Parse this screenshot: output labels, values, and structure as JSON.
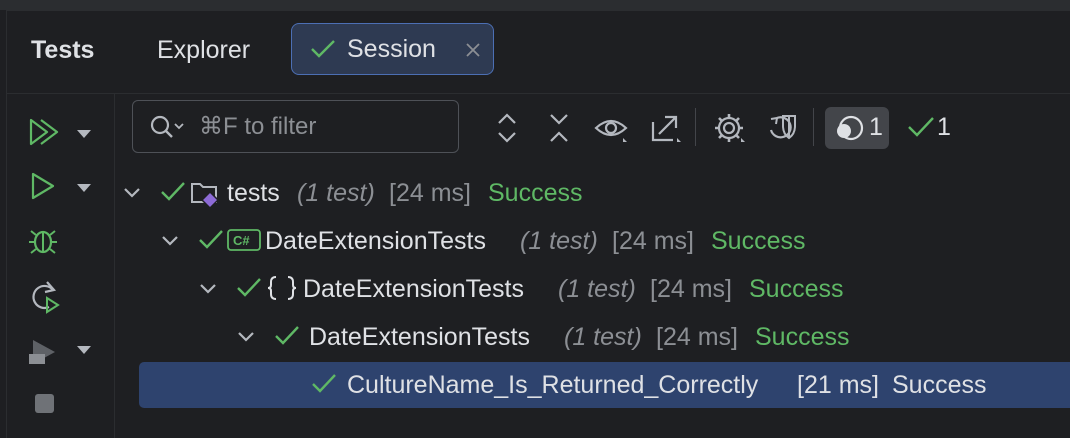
{
  "tabs": {
    "tests": "Tests",
    "explorer": "Explorer",
    "session": "Session"
  },
  "filter": {
    "placeholder": "⌘F to filter"
  },
  "counters": {
    "total": "1",
    "passed": "1"
  },
  "tree": [
    {
      "name": "tests",
      "count": "(1 test)",
      "time": "[24 ms]",
      "status": "Success",
      "icon": "folder-icon"
    },
    {
      "name": "DateExtensionTests",
      "count": "(1 test)",
      "time": "[24 ms]",
      "status": "Success",
      "icon": "csharp-file-icon"
    },
    {
      "name": "DateExtensionTests",
      "count": "(1 test)",
      "time": "[24 ms]",
      "status": "Success",
      "icon": "namespace-icon"
    },
    {
      "name": "DateExtensionTests",
      "count": "(1 test)",
      "time": "[24 ms]",
      "status": "Success",
      "icon": ""
    },
    {
      "name": "CultureName_Is_Returned_Correctly",
      "time": "[21 ms]",
      "status": "Success"
    }
  ],
  "colors": {
    "accent": "#4c6fb4",
    "success": "#5fb865",
    "selection": "#2e436e",
    "background": "#1e1f22"
  }
}
